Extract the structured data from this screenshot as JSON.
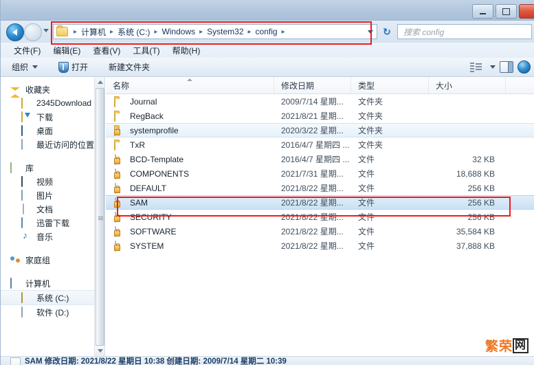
{
  "window": {
    "controls": {
      "minimize": "minimize-button",
      "maximize": "maximize-button",
      "close": "close-button"
    }
  },
  "address": {
    "back_label": "◀",
    "forward_label": "▶",
    "breadcrumbs": [
      "计算机",
      "系统 (C:)",
      "Windows",
      "System32",
      "config"
    ],
    "separator": "▸",
    "trailing_separator": "▸",
    "dropdown": "▾",
    "refresh": "↻"
  },
  "search": {
    "placeholder": "搜索 config"
  },
  "menu": {
    "items": [
      {
        "label": "文件(F)"
      },
      {
        "label": "编辑(E)"
      },
      {
        "label": "查看(V)"
      },
      {
        "label": "工具(T)"
      },
      {
        "label": "帮助(H)"
      }
    ]
  },
  "toolbar": {
    "organize_label": "组织",
    "open_label": "打开",
    "new_folder_label": "新建文件夹"
  },
  "sidebar": {
    "groups": [
      {
        "header": "收藏夹",
        "icon": "star-icon",
        "items": [
          {
            "label": "2345Download",
            "icon": "folder-icon"
          },
          {
            "label": "下载",
            "icon": "download-folder-icon"
          },
          {
            "label": "桌面",
            "icon": "desktop-icon"
          },
          {
            "label": "最近访问的位置",
            "icon": "recent-places-icon"
          }
        ]
      },
      {
        "header": "库",
        "icon": "library-folder-icon",
        "items": [
          {
            "label": "视频",
            "icon": "video-icon"
          },
          {
            "label": "图片",
            "icon": "picture-icon"
          },
          {
            "label": "文档",
            "icon": "document-icon"
          },
          {
            "label": "迅雷下载",
            "icon": "thunder-download-icon"
          },
          {
            "label": "音乐",
            "icon": "music-icon"
          }
        ]
      },
      {
        "header": "家庭组",
        "icon": "homegroup-icon",
        "items": []
      },
      {
        "header": "计算机",
        "icon": "computer-icon",
        "items": [
          {
            "label": "系统 (C:)",
            "icon": "system-drive-icon",
            "selected": true
          },
          {
            "label": "软件 (D:)",
            "icon": "drive-icon"
          }
        ]
      }
    ]
  },
  "file_list": {
    "columns": [
      {
        "label": "名称"
      },
      {
        "label": "修改日期"
      },
      {
        "label": "类型"
      },
      {
        "label": "大小"
      }
    ],
    "rows": [
      {
        "name": "Journal",
        "date": "2009/7/14 星期...",
        "type": "文件夹",
        "size": "",
        "icon": "folder-icon",
        "state": "normal"
      },
      {
        "name": "RegBack",
        "date": "2021/8/21 星期...",
        "type": "文件夹",
        "size": "",
        "icon": "folder-icon",
        "state": "normal"
      },
      {
        "name": "systemprofile",
        "date": "2020/3/22 星期...",
        "type": "文件夹",
        "size": "",
        "icon": "locked-folder-icon",
        "state": "hover"
      },
      {
        "name": "TxR",
        "date": "2016/4/7 星期四 ...",
        "type": "文件夹",
        "size": "",
        "icon": "folder-icon",
        "state": "normal"
      },
      {
        "name": "BCD-Template",
        "date": "2016/4/7 星期四 ...",
        "type": "文件",
        "size": "32 KB",
        "icon": "locked-file-icon",
        "state": "normal"
      },
      {
        "name": "COMPONENTS",
        "date": "2021/7/31 星期...",
        "type": "文件",
        "size": "18,688 KB",
        "icon": "locked-file-icon",
        "state": "normal"
      },
      {
        "name": "DEFAULT",
        "date": "2021/8/22 星期...",
        "type": "文件",
        "size": "256 KB",
        "icon": "locked-file-icon",
        "state": "normal"
      },
      {
        "name": "SAM",
        "date": "2021/8/22 星期...",
        "type": "文件",
        "size": "256 KB",
        "icon": "locked-file-icon",
        "state": "selected"
      },
      {
        "name": "SECURITY",
        "date": "2021/8/22 星期...",
        "type": "文件",
        "size": "256 KB",
        "icon": "locked-file-icon",
        "state": "normal"
      },
      {
        "name": "SOFTWARE",
        "date": "2021/8/22 星期...",
        "type": "文件",
        "size": "35,584 KB",
        "icon": "locked-file-icon",
        "state": "normal"
      },
      {
        "name": "SYSTEM",
        "date": "2021/8/22 星期...",
        "type": "文件",
        "size": "37,888 KB",
        "icon": "locked-file-icon",
        "state": "normal"
      }
    ]
  },
  "status_bar": {
    "text": "SAM 修改日期: 2021/8/22 星期日 10:38 创建日期: 2009/7/14 星期二 10:39"
  },
  "watermark": {
    "text_primary": "繁荣",
    "text_boxed": "网"
  },
  "annotations": {
    "address_highlight_color": "#ef1a1a",
    "sam_highlight_color": "#ef1a1a"
  }
}
